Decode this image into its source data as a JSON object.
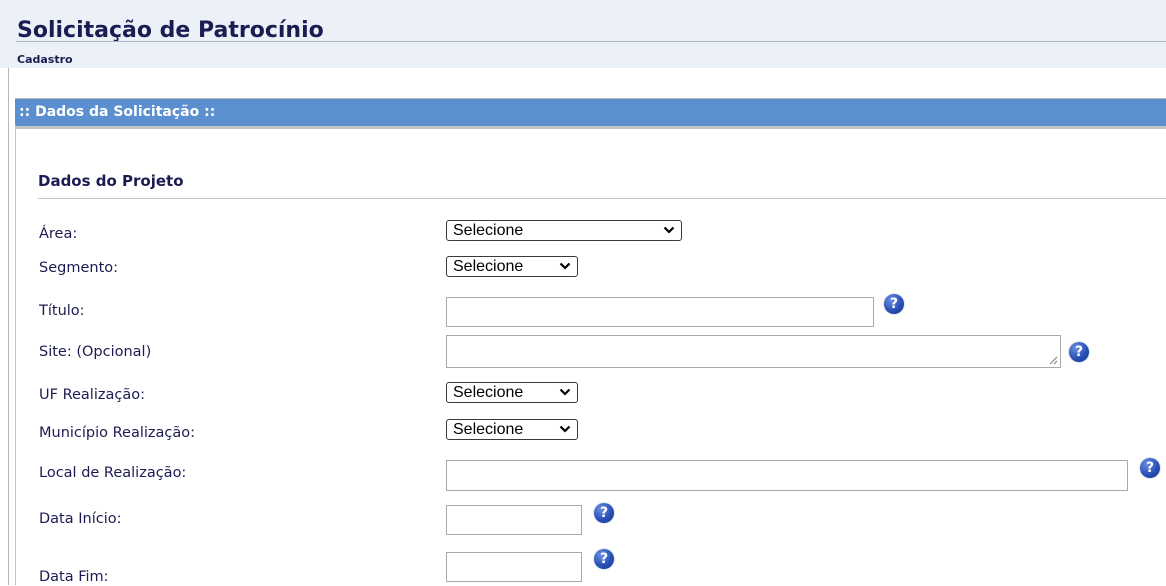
{
  "header": {
    "title": "Solicitação de Patrocínio",
    "subtitle": "Cadastro"
  },
  "section": {
    "title": ":: Dados da Solicitação ::",
    "bar_color": "#5b8fcf"
  },
  "group": {
    "title": "Dados do Projeto"
  },
  "fields": {
    "area": {
      "label": "Área:",
      "value": "Selecione"
    },
    "segmento": {
      "label": "Segmento:",
      "value": "Selecione"
    },
    "titulo": {
      "label": "Título:",
      "value": ""
    },
    "site": {
      "label": "Site: (Opcional)",
      "value": ""
    },
    "uf": {
      "label": "UF Realização:",
      "value": "Selecione"
    },
    "municipio": {
      "label": "Município Realização:",
      "value": "Selecione"
    },
    "local": {
      "label": "Local de Realização:",
      "value": ""
    },
    "data_inicio": {
      "label": "Data Início:",
      "value": ""
    },
    "data_fim": {
      "label": "Data Fim:",
      "value": ""
    }
  },
  "icons": {
    "help": "help-question-icon",
    "dropdown": "chevron-down-icon"
  }
}
